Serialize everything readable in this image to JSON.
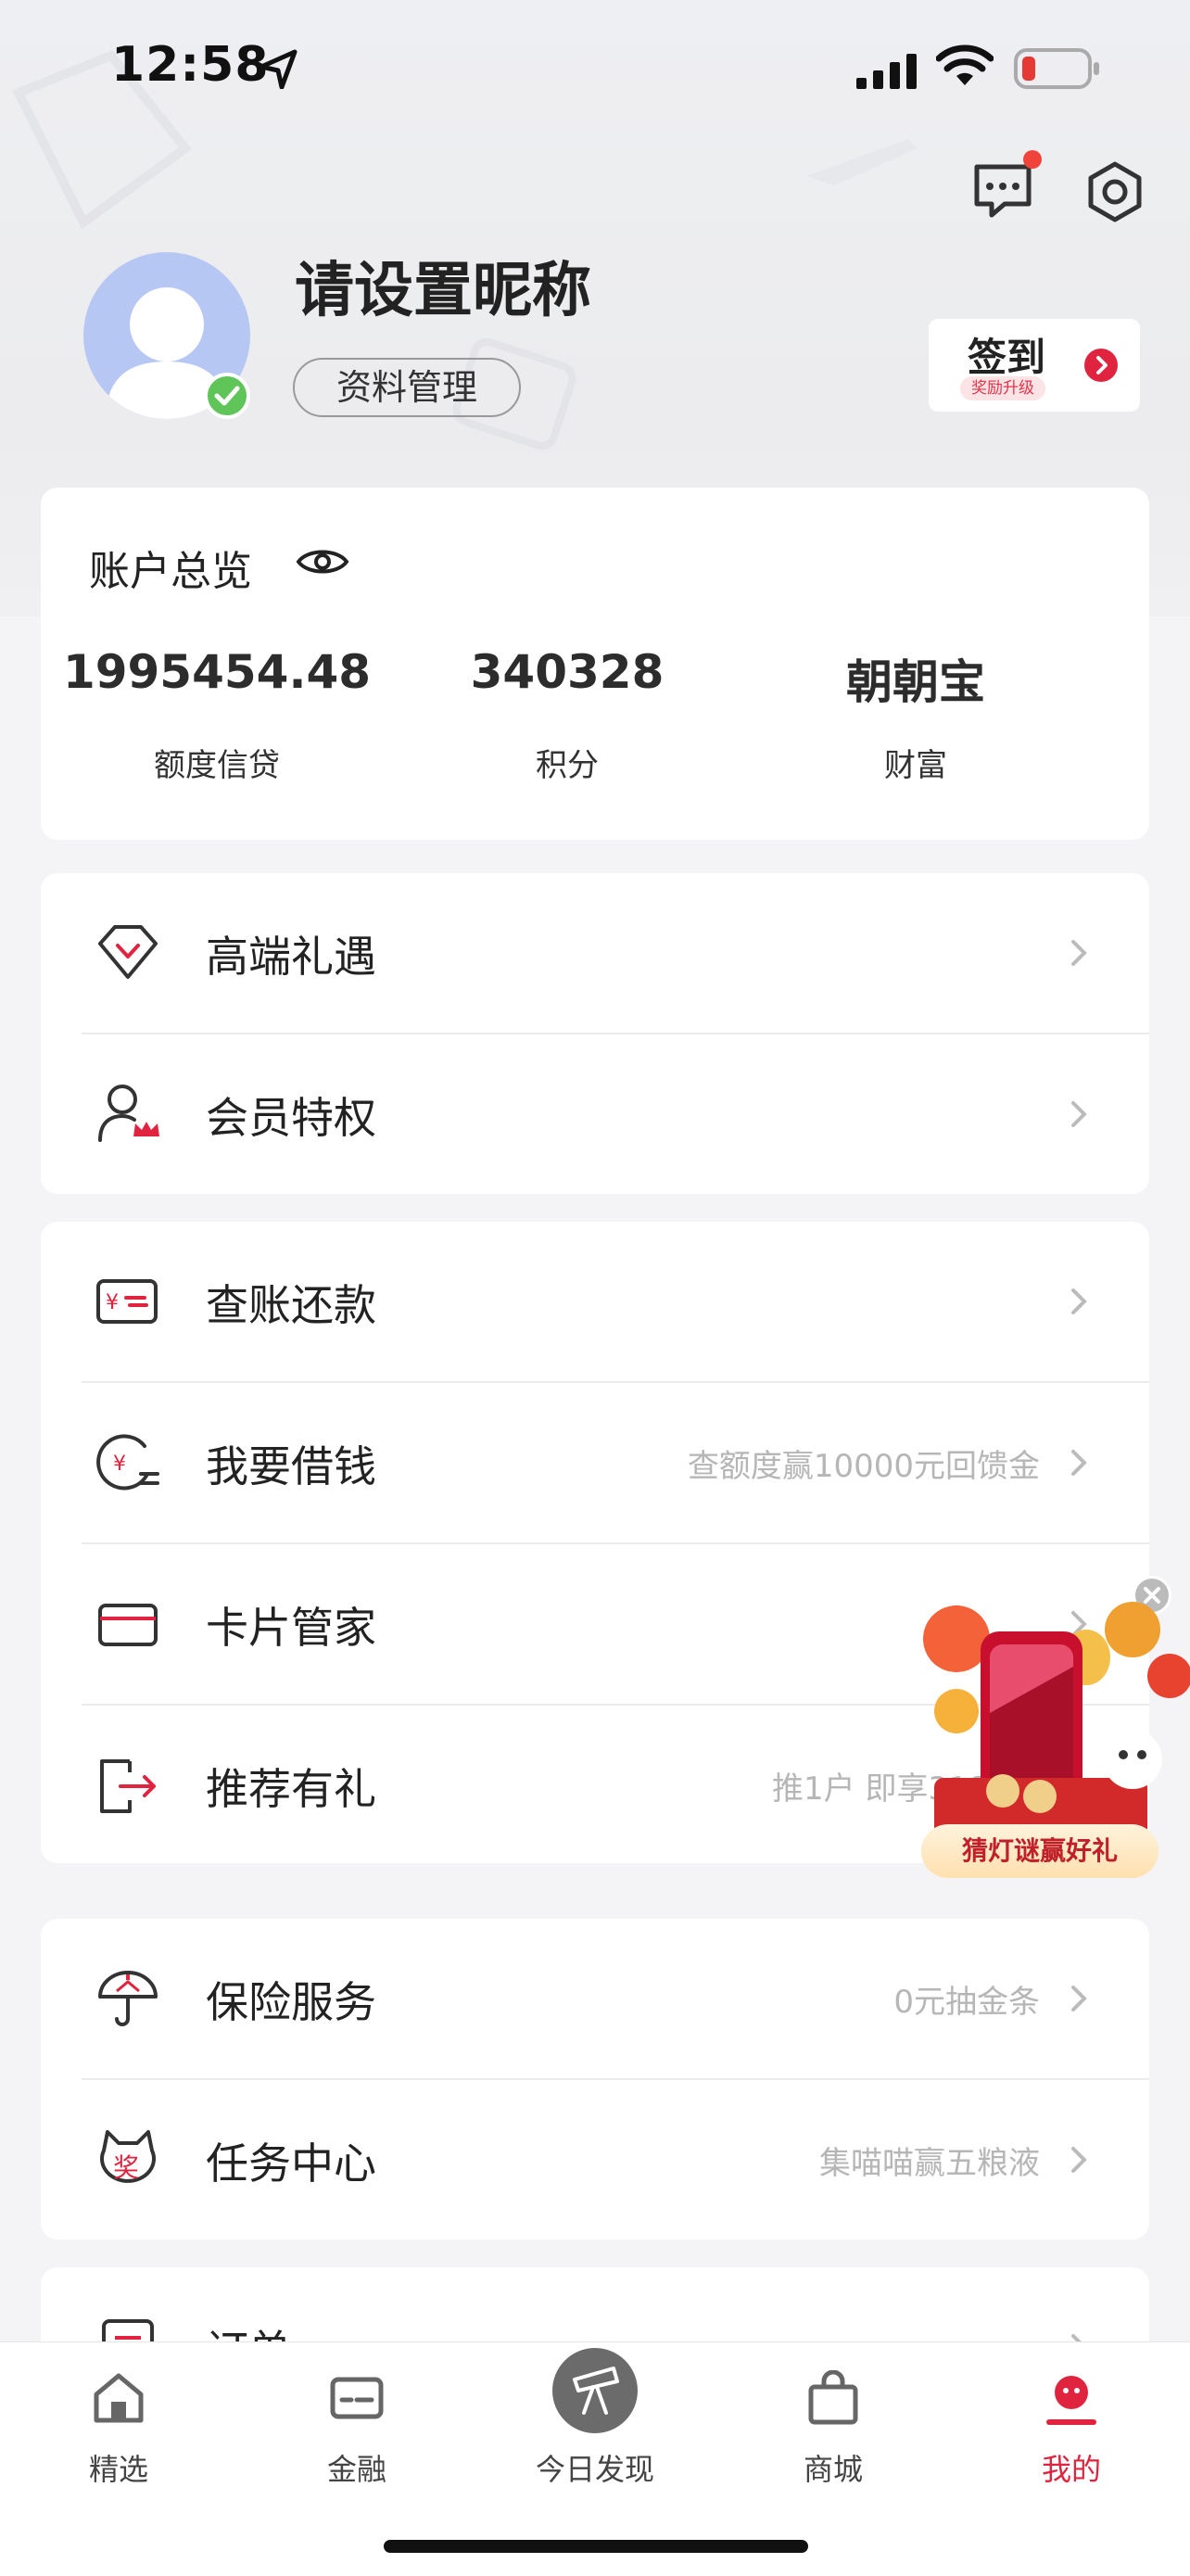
{
  "status_bar": {
    "time": "12:58"
  },
  "profile": {
    "nickname": "请设置昵称",
    "manage_label": "资料管理",
    "checkin_label": "签到",
    "checkin_badge": "奖励升级"
  },
  "overview": {
    "title": "账户总览",
    "stats": [
      {
        "value": "1995454.48",
        "label": "额度信贷"
      },
      {
        "value": "340328",
        "label": "积分"
      },
      {
        "value": "朝朝宝",
        "label": "财富"
      }
    ]
  },
  "menu": {
    "group1": [
      {
        "title": "高端礼遇",
        "icon": "diamond-icon"
      },
      {
        "title": "会员特权",
        "icon": "member-crown-icon"
      }
    ],
    "group2": [
      {
        "title": "查账还款",
        "icon": "bill-repay-icon"
      },
      {
        "title": "我要借钱",
        "icon": "borrow-icon",
        "sub": "查额度赢10000元回馈金"
      },
      {
        "title": "卡片管家",
        "icon": "card-icon"
      },
      {
        "title": "推荐有礼",
        "icon": "refer-icon",
        "sub": "推1户 即享3180元"
      }
    ],
    "group3": [
      {
        "title": "保险服务",
        "icon": "umbrella-icon",
        "sub": "0元抽金条"
      },
      {
        "title": "任务中心",
        "icon": "task-center-icon",
        "sub": "集喵喵赢五粮液"
      }
    ],
    "group4": [
      {
        "title": "订单",
        "icon": "order-icon"
      }
    ]
  },
  "promo": {
    "label": "猜灯谜赢好礼"
  },
  "tabbar": [
    {
      "label": "精选",
      "icon": "home-icon"
    },
    {
      "label": "金融",
      "icon": "finance-card-icon"
    },
    {
      "label": "今日发现",
      "icon": "telescope-icon"
    },
    {
      "label": "商城",
      "icon": "shopping-bag-icon"
    },
    {
      "label": "我的",
      "icon": "profile-icon",
      "active": true
    }
  ],
  "colors": {
    "accent": "#e0243f",
    "verified": "#5fc559",
    "avatar": "#b7c7f4"
  }
}
